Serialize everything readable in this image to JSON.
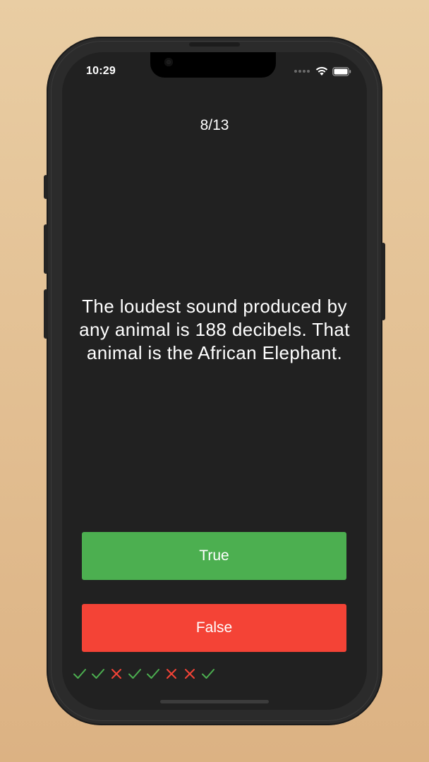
{
  "status_bar": {
    "time": "10:29",
    "icons": [
      "signal-dots-icon",
      "wifi-icon",
      "battery-icon"
    ]
  },
  "quiz": {
    "progress": "8/13",
    "question": "The loudest sound produced by any animal is 188 decibels. That animal is the African Elephant.",
    "true_label": "True",
    "false_label": "False"
  },
  "score_marks": [
    "correct",
    "correct",
    "wrong",
    "correct",
    "correct",
    "wrong",
    "wrong",
    "correct"
  ],
  "colors": {
    "background_top": "#e9cda3",
    "background_bottom": "#dcb283",
    "screen": "#212121",
    "true_button": "#4caf50",
    "false_button": "#f44336",
    "correct_mark": "#4caf50",
    "wrong_mark": "#f44336",
    "text": "#ffffff"
  }
}
